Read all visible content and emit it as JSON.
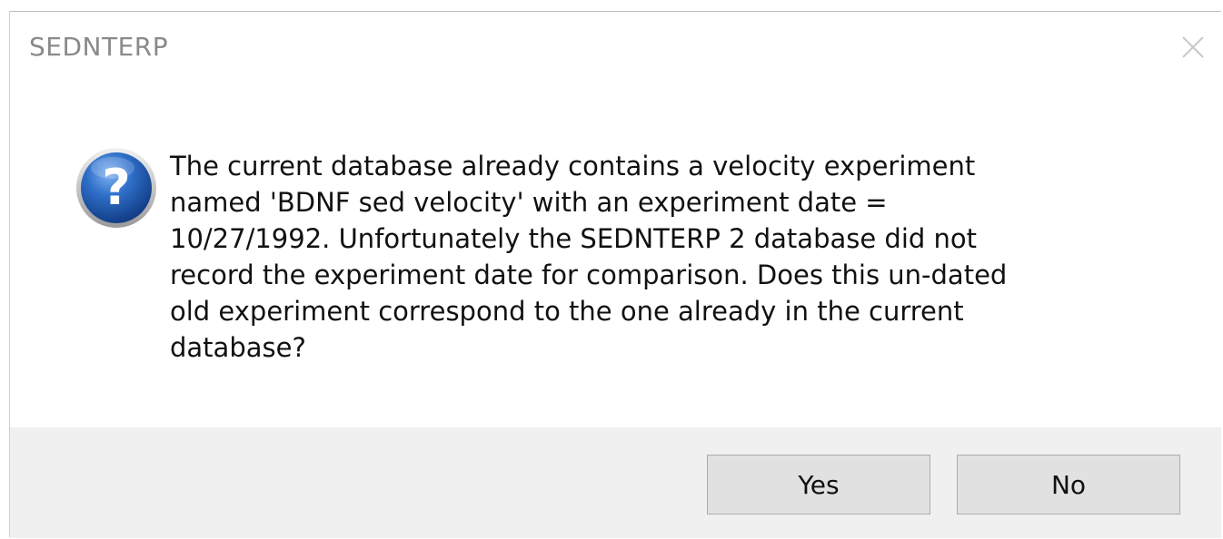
{
  "window": {
    "title": "SEDNTERP"
  },
  "icons": {
    "close": "close-icon",
    "question": "question-icon",
    "question_color": "#1f5fb5"
  },
  "message": {
    "lines": [
      "The current database already contains a velocity experiment",
      "named 'BDNF sed velocity' with an experiment date =",
      "10/27/1992. Unfortunately the SEDNTERP 2 database did not",
      "record the experiment date for comparison. Does this un-dated",
      "old experiment correspond to the one already in the current",
      "database?"
    ]
  },
  "buttons": {
    "yes_label": "Yes",
    "no_label": "No"
  }
}
